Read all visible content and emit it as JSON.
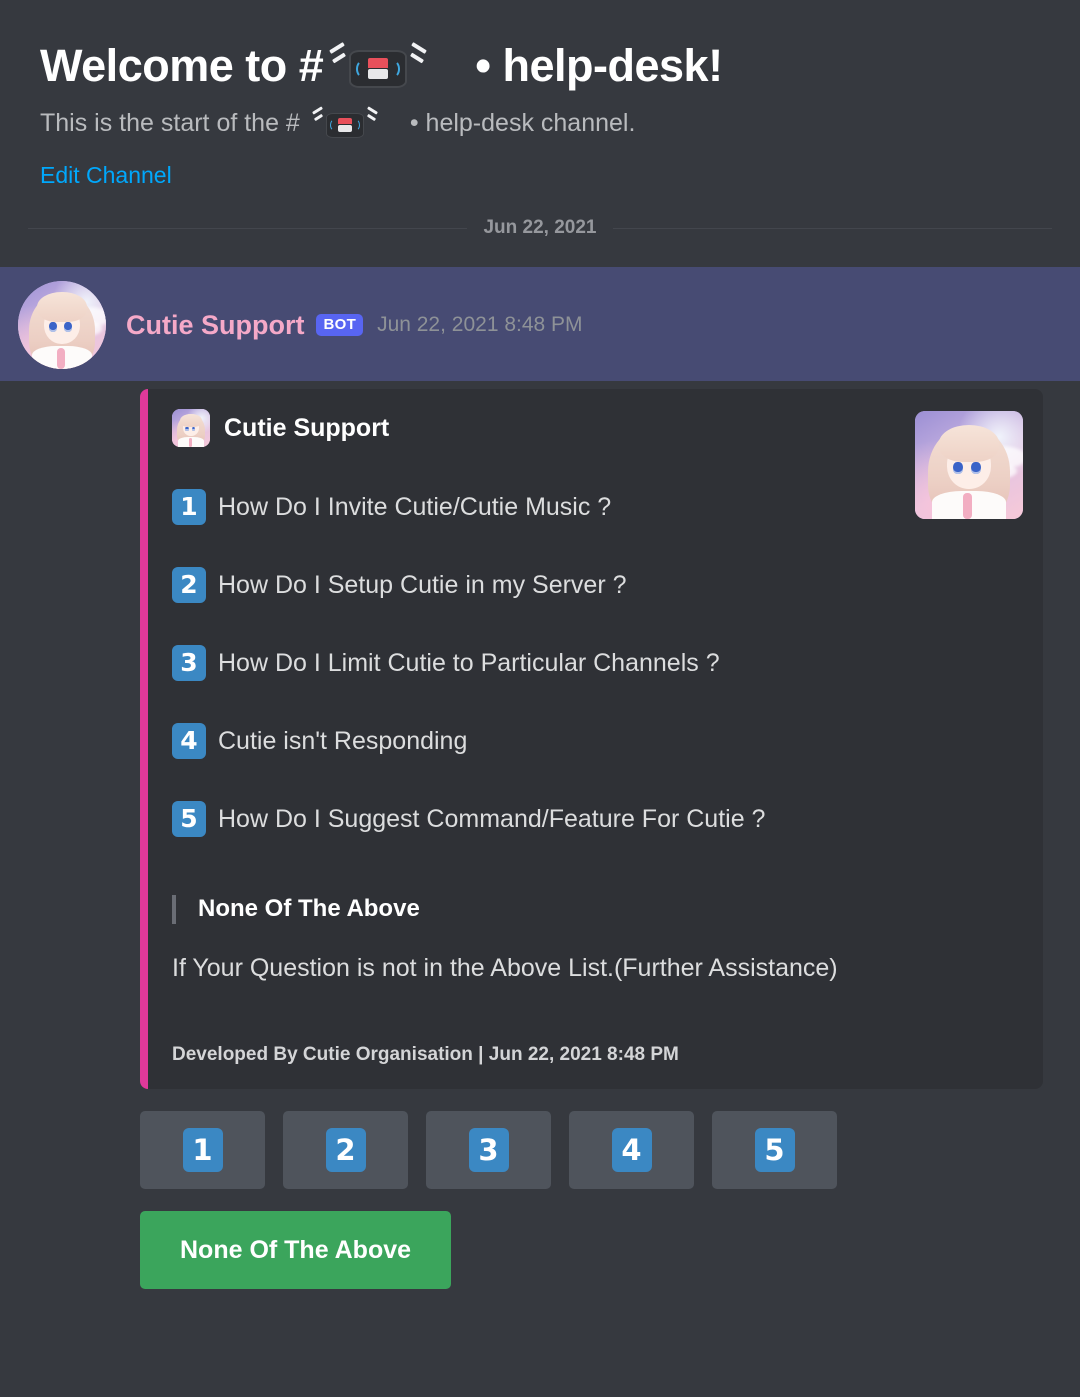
{
  "channel": {
    "welcome_prefix": "Welcome to #",
    "welcome_suffix": "• help-desk!",
    "start_prefix": "This is the start of the #",
    "start_suffix": "• help-desk channel.",
    "edit_channel_label": "Edit Channel",
    "channel_emoji_name": "vhs-tape-emoji"
  },
  "divider": {
    "date": "Jun 22, 2021"
  },
  "message": {
    "author": "Cutie Support",
    "bot_badge": "BOT",
    "timestamp": "Jun 22, 2021 8:48 PM",
    "avatar_name": "cutie-support-avatar"
  },
  "embed": {
    "author_name": "Cutie Support",
    "accent_color": "#e0399a",
    "background_color": "#2f3136",
    "thumbnail_name": "cutie-support-thumbnail",
    "items": [
      {
        "number": "1",
        "text": "How Do I Invite Cutie/Cutie Music ?"
      },
      {
        "number": "2",
        "text": "How Do I Setup Cutie in my Server ?"
      },
      {
        "number": "3",
        "text": "How Do I Limit Cutie to Particular Channels ?"
      },
      {
        "number": "4",
        "text": "Cutie isn't Responding"
      },
      {
        "number": "5",
        "text": "How Do I Suggest Command/Feature For Cutie ?"
      }
    ],
    "field": {
      "name": "None Of The Above",
      "value": "If Your Question is not in the Above List.(Further Assistance)"
    },
    "footer": "Developed By Cutie Organisation | Jun 22, 2021 8:48 PM"
  },
  "components": {
    "number_buttons": [
      {
        "number": "1"
      },
      {
        "number": "2"
      },
      {
        "number": "3"
      },
      {
        "number": "4"
      },
      {
        "number": "5"
      }
    ],
    "none_button_label": "None Of The Above",
    "none_button_color": "#3ba55c"
  }
}
